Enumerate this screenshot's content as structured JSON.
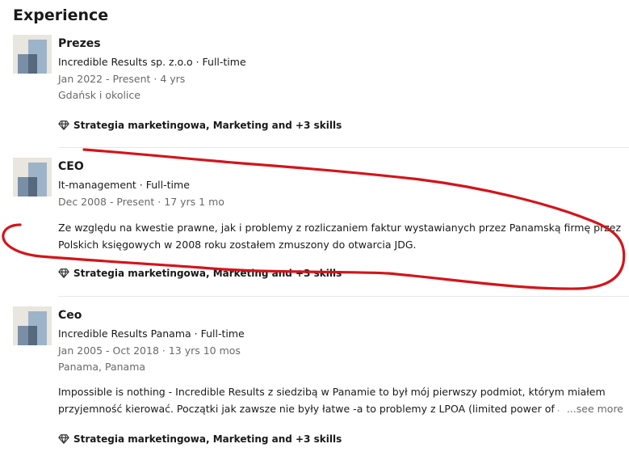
{
  "section": {
    "title": "Experience"
  },
  "experiences": [
    {
      "role": "Prezes",
      "company": "Incredible Results sp. z.o.o · Full-time",
      "dates": "Jan 2022 - Present · 4 yrs",
      "location": "Gdańsk i okolice",
      "skills": "Strategia marketingowa, Marketing and +3 skills"
    },
    {
      "role": "CEO",
      "company": "It-management · Full-time",
      "dates": "Dec 2008 - Present · 17 yrs 1 mo",
      "description_lines": [
        "Ze względu na kwestie prawne, jak i problemy z rozliczaniem faktur wystawianych przez Panamską firmę przez",
        "Polskich księgowych w 2008 roku zostałem zmuszony do otwarcia JDG."
      ],
      "skills": "Strategia marketingowa, Marketing and +3 skills"
    },
    {
      "role": "Ceo",
      "company": "Incredible Results Panama · Full-time",
      "dates": "Jan 2005 - Oct 2018 · 13 yrs 10 mos",
      "location": "Panama, Panama",
      "description_lines": [
        "Impossible is nothing - Incredible Results z siedzibą w Panamie to był mój pierwszy podmiot, którym miałem",
        "przyjemność kierować. Początki jak zawsze nie były łatwe -a to problemy z LPOA (limited power of att"
      ],
      "see_more": "...see more",
      "skills": "Strategia marketingowa, Marketing and +3 skills"
    }
  ],
  "icons": {
    "skills": "diamond-icon",
    "logo": "company-logo-icon"
  },
  "colors": {
    "annotation": "#d4141b",
    "logo_bg": "#e9e5df",
    "logo_light": "#9db3c8",
    "logo_dark": "#56697e"
  }
}
